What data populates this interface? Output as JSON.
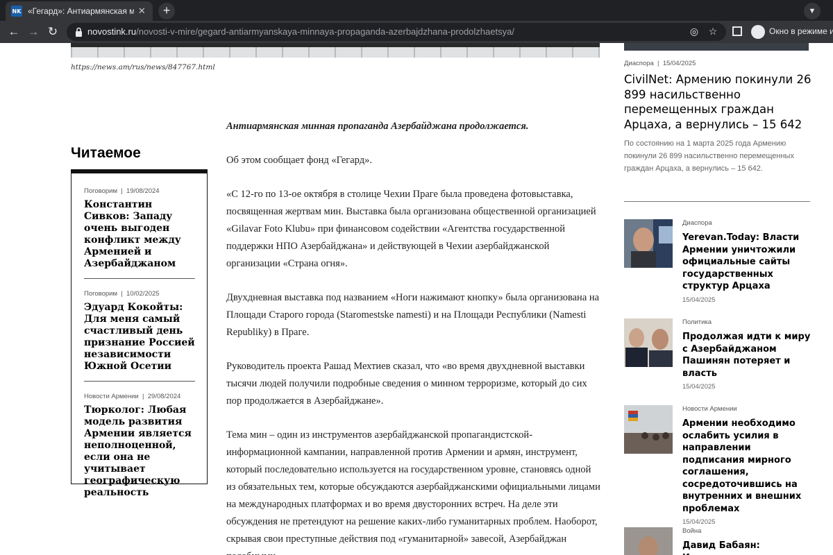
{
  "browser": {
    "tab_title": "«Гегард»: Антиармянская минная",
    "favicon_text": "NK",
    "url_host": "novostink.ru",
    "url_path": "/novosti-v-mire/gegard-antiarmyanskaya-minnaya-propaganda-azerbajdzhana-prodolzhaetsya/",
    "incognito_text": "Окно в режиме инк"
  },
  "article": {
    "image_caption": "https://news.am/rus/news/847767.html",
    "paragraphs": [
      "Антиармянская минная пропаганда Азербайджана продолжается.",
      "Об этом сообщает фонд «Гегард».",
      "«С 12-го по 13-ое октября в столице Чехии Праге была проведена фотовыставка, посвященная жертвам мин. Выставка была организована общественной организацией «Gilavar Foto Klubu» при финансовом содействии «Агентства государственной поддержки НПО Азербайджана» и действующей в Чехии азербайджанской организации «Страна огня».",
      "Двухдневная выставка под названием «Ноги нажимают кнопку» была организована на Площади Старого города (Staromestske namesti) и на Площади Республики (Namesti Republiky) в Праге.",
      "Руководитель проекта Рашад Мехтиев сказал, что «во время двухдневной выставки тысячи людей получили подробные сведения о минном терроризме, который до сих пор продолжается в Азербайджане».",
      "Тема мин – один из инструментов азербайджанской пропагандистской-информационной кампании, направленной против Армении и армян, инструмент, который последовательно используется на государственном уровне, становясь одной из обязательных тем, которые обсуждаются азербайджанскими официальными лицами на международных платформах и во время двусторонних встреч. На деле эти обсуждения не претендуют на решение каких-либо гуманитарных проблем. Наоборот, скрывая свои преступные действия под «гуманитарной» завесой, Азербайджан подобными"
    ]
  },
  "read": {
    "heading": "Читаемое",
    "items": [
      {
        "category": "Поговорим",
        "date": "19/08/2024",
        "title": "Константин Сивков: Западу очень выгоден конфликт между Арменией и Азербайджаном"
      },
      {
        "category": "Поговорим",
        "date": "10/02/2025",
        "title": "Эдуард Кокойты: Для меня самый счастливый день признание Россией независимости Южной Осетии"
      },
      {
        "category": "Новости Армении",
        "date": "29/08/2024",
        "title": "Тюрколог: Любая модель развития Армении является неполноценной, если она не учитывает географическую реальность"
      }
    ]
  },
  "sidebar": {
    "featured": {
      "category": "Диаспора",
      "date": "15/04/2025",
      "title": "CivilNet: Армению покинули 26 899 насильственно перемещенных граждан Арцаха, а вернулись – 15 642",
      "excerpt": "По состоянию на 1 марта 2025 года Армению покинули 26 899 насильственно перемещенных граждан Арцаха, а вернулись – 15 642."
    },
    "cards": [
      {
        "category": "Диаспора",
        "title": "Yerevan.Today: Власти Армении уничтожили официальные сайты государственных структур Арцаха",
        "date": "15/04/2025"
      },
      {
        "category": "Политика",
        "title": "Продолжая идти к миру с Азербайджаном Пашинян потеряет и власть",
        "date": "15/04/2025"
      },
      {
        "category": "Новости Армении",
        "title": "Армении необходимо ослабить усилия в направлении подписания мирного соглашения, сосредоточившись на внутренних и внешних проблемах",
        "date": "15/04/2025"
      },
      {
        "category": "Война",
        "title": "Давид Бабаян: Интересно армян в",
        "date": ""
      }
    ]
  }
}
